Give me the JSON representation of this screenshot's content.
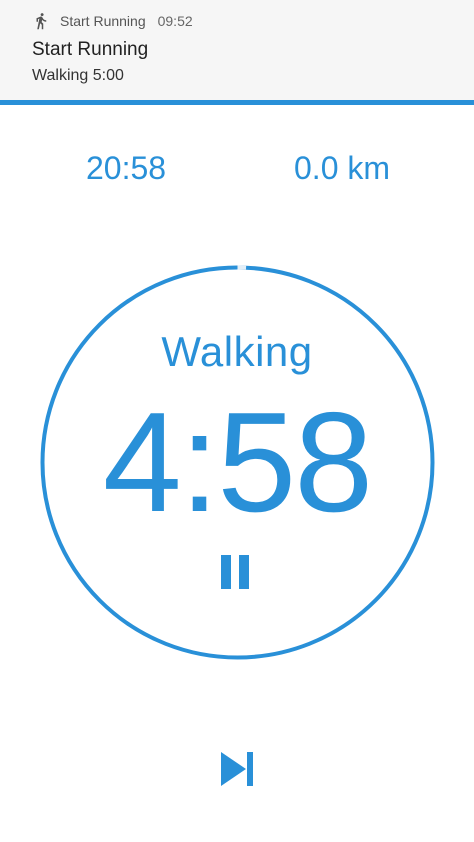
{
  "notification": {
    "app_name": "Start Running",
    "time": "09:52",
    "title": "Start Running",
    "text": "Walking 5:00"
  },
  "stats": {
    "elapsed_time": "20:58",
    "distance": "0.0 km"
  },
  "timer": {
    "phase": "Walking",
    "remaining": "4:58",
    "progress_fraction": 0.007
  },
  "controls": {
    "pause_icon": "pause-icon",
    "skip_icon": "skip-next-icon"
  },
  "colors": {
    "accent": "#2990d8",
    "notification_bg": "#f6f6f6"
  }
}
